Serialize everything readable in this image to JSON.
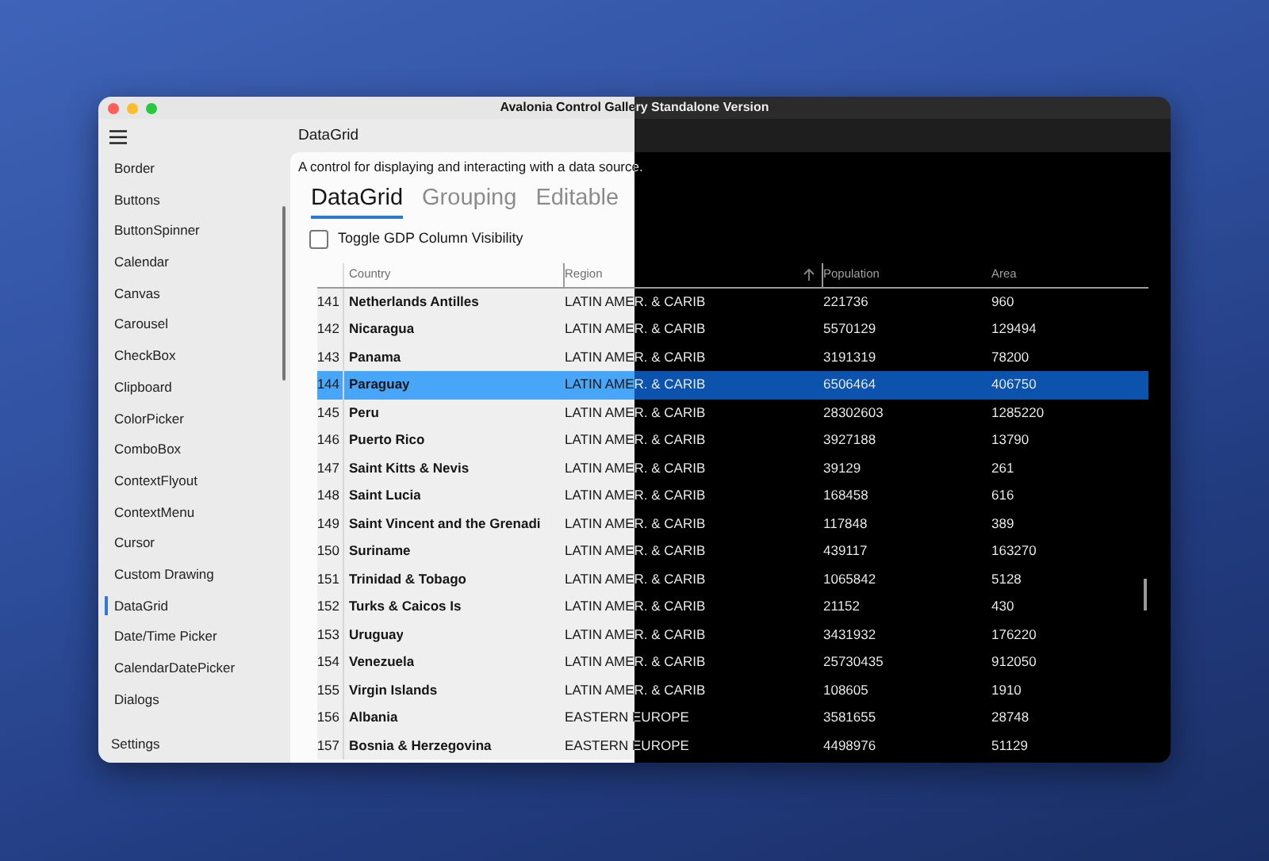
{
  "window": {
    "title": "Avalonia Control Gallery Standalone Version"
  },
  "sidebar": {
    "items": [
      {
        "label": "Border",
        "selected": false
      },
      {
        "label": "Buttons",
        "selected": false
      },
      {
        "label": "ButtonSpinner",
        "selected": false
      },
      {
        "label": "Calendar",
        "selected": false
      },
      {
        "label": "Canvas",
        "selected": false
      },
      {
        "label": "Carousel",
        "selected": false
      },
      {
        "label": "CheckBox",
        "selected": false
      },
      {
        "label": "Clipboard",
        "selected": false
      },
      {
        "label": "ColorPicker",
        "selected": false
      },
      {
        "label": "ComboBox",
        "selected": false
      },
      {
        "label": "ContextFlyout",
        "selected": false
      },
      {
        "label": "ContextMenu",
        "selected": false
      },
      {
        "label": "Cursor",
        "selected": false
      },
      {
        "label": "Custom Drawing",
        "selected": false
      },
      {
        "label": "DataGrid",
        "selected": true
      },
      {
        "label": "Date/Time Picker",
        "selected": false
      },
      {
        "label": "CalendarDatePicker",
        "selected": false
      },
      {
        "label": "Dialogs",
        "selected": false
      }
    ],
    "settings": "Settings"
  },
  "page": {
    "title": "DataGrid",
    "description": "A control for displaying and interacting with a data source.",
    "tabs": [
      {
        "label": "DataGrid",
        "selected": true
      },
      {
        "label": "Grouping",
        "selected": false
      },
      {
        "label": "Editable",
        "selected": false
      }
    ],
    "checkbox": {
      "label": "Toggle GDP Column Visibility",
      "checked": false
    }
  },
  "table": {
    "columns": [
      {
        "label": "Country",
        "sorted": false
      },
      {
        "label": "Region",
        "sorted": true
      },
      {
        "label": "Population",
        "sorted": false
      },
      {
        "label": "Area",
        "sorted": false
      }
    ],
    "rows": [
      {
        "number": "141",
        "country": "Netherlands Antilles",
        "region": "LATIN AMER. & CARIB",
        "population": "221736",
        "area": "960",
        "selected": false
      },
      {
        "number": "142",
        "country": "Nicaragua",
        "region": "LATIN AMER. & CARIB",
        "population": "5570129",
        "area": "129494",
        "selected": false
      },
      {
        "number": "143",
        "country": "Panama",
        "region": "LATIN AMER. & CARIB",
        "population": "3191319",
        "area": "78200",
        "selected": false
      },
      {
        "number": "144",
        "country": "Paraguay",
        "region": "LATIN AMER. & CARIB",
        "population": "6506464",
        "area": "406750",
        "selected": true
      },
      {
        "number": "145",
        "country": "Peru",
        "region": "LATIN AMER. & CARIB",
        "population": "28302603",
        "area": "1285220",
        "selected": false
      },
      {
        "number": "146",
        "country": "Puerto Rico",
        "region": "LATIN AMER. & CARIB",
        "population": "3927188",
        "area": "13790",
        "selected": false
      },
      {
        "number": "147",
        "country": "Saint Kitts & Nevis",
        "region": "LATIN AMER. & CARIB",
        "population": "39129",
        "area": "261",
        "selected": false
      },
      {
        "number": "148",
        "country": "Saint Lucia",
        "region": "LATIN AMER. & CARIB",
        "population": "168458",
        "area": "616",
        "selected": false
      },
      {
        "number": "149",
        "country": "Saint Vincent and the Grenadi",
        "region": "LATIN AMER. & CARIB",
        "population": "117848",
        "area": "389",
        "selected": false
      },
      {
        "number": "150",
        "country": "Suriname",
        "region": "LATIN AMER. & CARIB",
        "population": "439117",
        "area": "163270",
        "selected": false
      },
      {
        "number": "151",
        "country": "Trinidad & Tobago",
        "region": "LATIN AMER. & CARIB",
        "population": "1065842",
        "area": "5128",
        "selected": false
      },
      {
        "number": "152",
        "country": "Turks & Caicos Is",
        "region": "LATIN AMER. & CARIB",
        "population": "21152",
        "area": "430",
        "selected": false
      },
      {
        "number": "153",
        "country": "Uruguay",
        "region": "LATIN AMER. & CARIB",
        "population": "3431932",
        "area": "176220",
        "selected": false
      },
      {
        "number": "154",
        "country": "Venezuela",
        "region": "LATIN AMER. & CARIB",
        "population": "25730435",
        "area": "912050",
        "selected": false
      },
      {
        "number": "155",
        "country": "Virgin Islands",
        "region": "LATIN AMER. & CARIB",
        "population": "108605",
        "area": "1910",
        "selected": false
      },
      {
        "number": "156",
        "country": "Albania",
        "region": "EASTERN EUROPE",
        "population": "3581655",
        "area": "28748",
        "selected": false
      },
      {
        "number": "157",
        "country": "Bosnia & Herzegovina",
        "region": "EASTERN EUROPE",
        "population": "4498976",
        "area": "51129",
        "selected": false
      }
    ]
  }
}
